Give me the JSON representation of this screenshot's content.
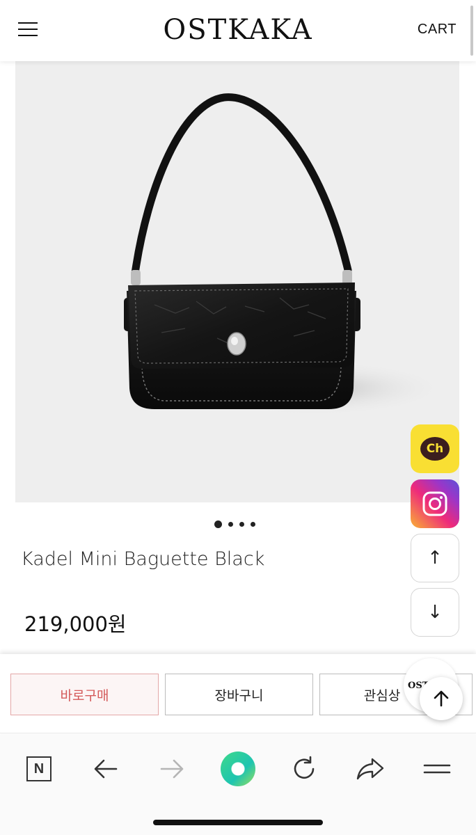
{
  "header": {
    "logo": "OSTKAKA",
    "cart_label": "CART",
    "menu_icon": "hamburger-menu-icon"
  },
  "product": {
    "image_icon": "black-baguette-bag-photo",
    "carousel": {
      "total": 4,
      "active": 1
    },
    "name": "Kadel Mini Baguette Black",
    "price": "219,000원"
  },
  "side_buttons": {
    "kakao_label": "Ch",
    "instagram_icon": "instagram-icon",
    "scroll_up": "↑",
    "scroll_down": "↓"
  },
  "actions": {
    "buy_now": "바로구매",
    "add_to_cart": "장바구니",
    "wishlist": "관심상",
    "badge_text": "OST"
  },
  "browser_toolbar": {
    "n_label": "N",
    "icons": [
      "naver-icon",
      "back-arrow-icon",
      "forward-arrow-icon",
      "green-assistant-icon",
      "refresh-icon",
      "share-icon",
      "menu-icon"
    ]
  },
  "colors": {
    "kakao_yellow": "#f9df33",
    "buy_button_text": "#d45a5a",
    "buy_button_border": "#e4a7a7"
  }
}
